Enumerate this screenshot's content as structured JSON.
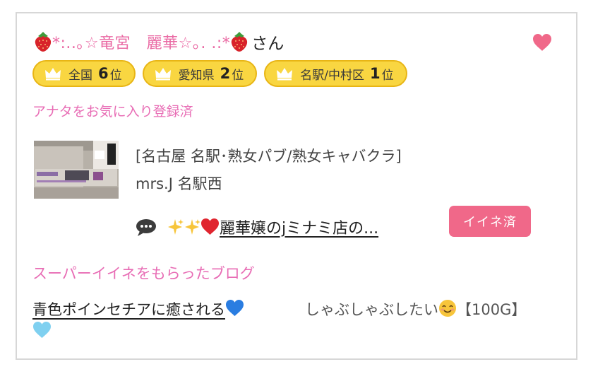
{
  "profile": {
    "name_decorated": "*:..｡☆竜宮　麗華☆｡. .:*",
    "honorific": "さん",
    "favorite_icon": "heart-icon"
  },
  "rankings": [
    {
      "region": "全国",
      "rank": "6",
      "suffix": "位"
    },
    {
      "region": "愛知県",
      "rank": "2",
      "suffix": "位"
    },
    {
      "region": "名駅/中村区",
      "rank": "1",
      "suffix": "位"
    }
  ],
  "favorite_status": "アナタをお気に入り登録済",
  "shop": {
    "category": "[名古屋 名駅･熟女パブ/熟女キャバクラ]",
    "name": "mrs.J 名駅西",
    "thumbnail_icon": "shop-photo"
  },
  "latest_post": {
    "title": "麗華嬢のjミナミ店の...",
    "iine_label": "イイネ済"
  },
  "super_iine": {
    "heading": "スーパーイイネをもらったブログ",
    "blogs": [
      {
        "title": "青色ポインセチアに癒される"
      },
      {
        "title_part1": "しゃぶしゃぶしたい",
        "title_part2": "【100G】"
      }
    ]
  },
  "colors": {
    "accent_pink": "#e86db5",
    "button_pink": "#f06889",
    "rank_yellow": "#f9d641",
    "heart": "#f06889"
  }
}
